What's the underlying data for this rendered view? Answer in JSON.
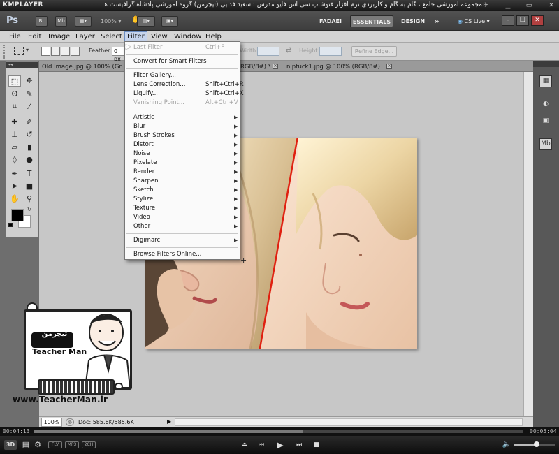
{
  "km_player": {
    "logo": "KMPLAYER",
    "title": "مجموعه آموزشی جامع ، گام به گام و کاربردی نرم افزار فتوشاپ سی اس فایو   مدرس : سعید فدایی (تیچرمن) گروه آموزشی پادشاه گرافیست ها",
    "time_elapsed": "00:04:13",
    "time_total": "00:05:04",
    "seek_progress": 0.55,
    "volume_level": 0.55,
    "badges": [
      "FLV",
      "MP3",
      "2CH"
    ]
  },
  "ps_appbar": {
    "logo": "Ps",
    "bridge_label": "Br",
    "minibridge_label": "Mb",
    "zoom": "100%",
    "workspaces": [
      "FADAEI",
      "ESSENTIALS",
      "DESIGN"
    ],
    "more": "»",
    "cs_live": "CS Live"
  },
  "menubar": {
    "items": [
      "File",
      "Edit",
      "Image",
      "Layer",
      "Select",
      "Filter",
      "View",
      "Window",
      "Help"
    ],
    "active": "Filter"
  },
  "options_bar": {
    "feather_label": "Feather:",
    "feather_value": "0 px",
    "width_label": "Width:",
    "height_label": "Height:",
    "refine_edge": "Refine Edge..."
  },
  "doc_tabs": [
    {
      "label": "Old Image.jpg @ 100% (Gr"
    },
    {
      "label": "RGB/8#) *"
    },
    {
      "label": "niptuck1.jpg @ 100% (RGB/8#)"
    }
  ],
  "status_bar": {
    "zoom": "100%",
    "doc": "Doc: 585.6K/585.6K"
  },
  "filter_menu": {
    "groups": [
      [
        {
          "label": "Last Filter",
          "shortcut": "Ctrl+F",
          "disabled": true
        }
      ],
      [
        {
          "label": "Convert for Smart Filters"
        }
      ],
      [
        {
          "label": "Filter Gallery..."
        },
        {
          "label": "Lens Correction...",
          "shortcut": "Shift+Ctrl+R"
        },
        {
          "label": "Liquify...",
          "shortcut": "Shift+Ctrl+X"
        },
        {
          "label": "Vanishing Point...",
          "shortcut": "Alt+Ctrl+V",
          "disabled": true
        }
      ],
      [
        {
          "label": "Artistic",
          "submenu": true
        },
        {
          "label": "Blur",
          "submenu": true
        },
        {
          "label": "Brush Strokes",
          "submenu": true
        },
        {
          "label": "Distort",
          "submenu": true
        },
        {
          "label": "Noise",
          "submenu": true
        },
        {
          "label": "Pixelate",
          "submenu": true
        },
        {
          "label": "Render",
          "submenu": true
        },
        {
          "label": "Sharpen",
          "submenu": true
        },
        {
          "label": "Sketch",
          "submenu": true
        },
        {
          "label": "Stylize",
          "submenu": true
        },
        {
          "label": "Texture",
          "submenu": true
        },
        {
          "label": "Video",
          "submenu": true
        },
        {
          "label": "Other",
          "submenu": true
        }
      ],
      [
        {
          "label": "Digimarc",
          "submenu": true
        }
      ],
      [
        {
          "label": "Browse Filters Online..."
        }
      ]
    ]
  },
  "watermark": {
    "brand_fa": "تیچرمن",
    "brand_en": "Teacher Man",
    "url": "www.TeacherMan.ir"
  },
  "colors": {
    "menu_active_bg": "#c6d4ec",
    "workspace_bg": "#c7c7c7",
    "divider_red": "#e02010"
  }
}
